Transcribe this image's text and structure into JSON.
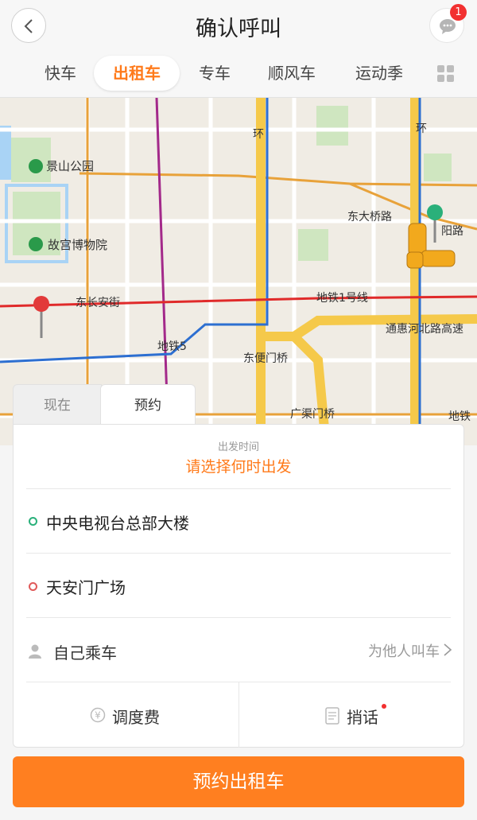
{
  "header": {
    "title": "确认呼叫",
    "badge_count": "1"
  },
  "tabs": [
    {
      "label": "快车"
    },
    {
      "label": "出租车",
      "active": true
    },
    {
      "label": "专车"
    },
    {
      "label": "顺风车"
    },
    {
      "label": "运动季"
    }
  ],
  "map": {
    "labels": {
      "jingshan": "景山公园",
      "gugong": "故宫博物院",
      "dongchangan": "东长安街",
      "subway1": "地铁1号线",
      "tonghui": "通惠河北路高速",
      "dongbianmen": "东便门桥",
      "guangqumen": "广渠门桥",
      "subway_right": "地铁",
      "dongdaqiao": "东大桥路",
      "huan1": "环",
      "huan2": "环",
      "subway5": "地铁5",
      "yanglu": "阳路"
    },
    "colors": {
      "bg": "#f0ece4",
      "major": "#f5c94a",
      "orange": "#e8a23a",
      "subway_red": "#e02a2a",
      "subway_blue": "#2d6fd1",
      "subway_purple": "#a3298a",
      "green": "#cfe6c0",
      "water": "#a9d3f5"
    }
  },
  "booking": {
    "tab_now": "现在",
    "tab_reserve": "预约",
    "time_label": "出发时间",
    "time_prompt": "请选择何时出发",
    "origin": "中央电视台总部大楼",
    "destination": "天安门广场",
    "passenger": "自己乘车",
    "for_other": "为他人叫车",
    "fee": "调度费",
    "message": "捎话"
  },
  "submit_label": "预约出租车",
  "accent_color": "#ff7a1a"
}
